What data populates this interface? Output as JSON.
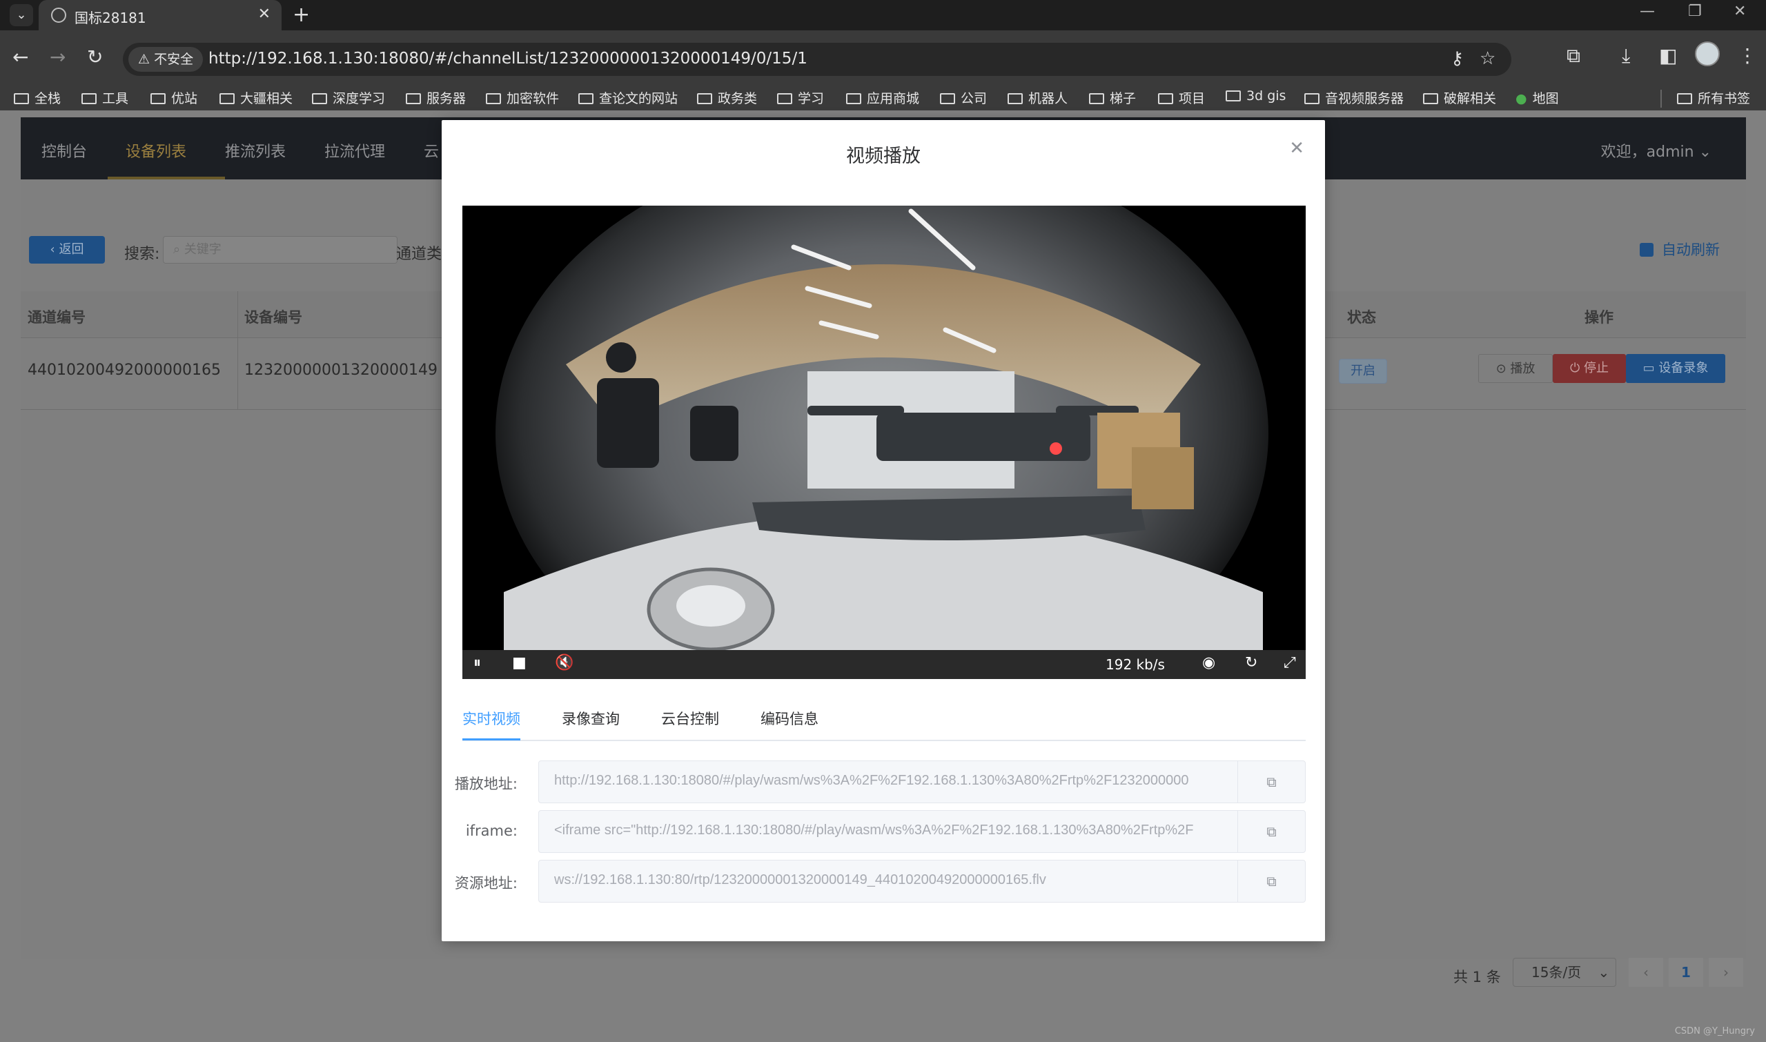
{
  "browser": {
    "tab_title": "国标28181",
    "insecure_label": "不安全",
    "url": "http://192.168.1.130:18080/#/channelList/12320000001320000149/0/15/1",
    "bookmarks": [
      "全栈",
      "工具",
      "优站",
      "大疆相关",
      "深度学习",
      "服务器",
      "加密软件",
      "查论文的网站",
      "政务类",
      "学习",
      "应用商城",
      "公司",
      "机器人",
      "梯子",
      "项目",
      "3d gis",
      "音视频服务器",
      "破解相关",
      "地图"
    ],
    "all_bookmarks": "所有书签"
  },
  "app": {
    "nav": [
      "控制台",
      "设备列表",
      "推流列表",
      "拉流代理",
      "云"
    ],
    "welcome": "欢迎，admin",
    "back_label": "返回",
    "search_label": "搜索:",
    "search_placeholder": "关键字",
    "channel_type_label": "通道类",
    "auto_refresh": "自动刷新",
    "table": {
      "headers": [
        "通道编号",
        "设备编号",
        "状态",
        "操作"
      ],
      "rows": [
        {
          "channel_id": "44010200492000000165",
          "device_id": "12320000001320000149",
          "status": "开启",
          "actions": [
            "播放",
            "停止",
            "设备录象"
          ]
        }
      ]
    },
    "pager": {
      "total": "共 1 条",
      "page_size": "15条/页",
      "current": "1"
    },
    "watermark": "CSDN @Y_Hungry"
  },
  "dialog": {
    "title": "视频播放",
    "bitrate": "192 kb/s",
    "tabs": [
      "实时视频",
      "录像查询",
      "云台控制",
      "编码信息"
    ],
    "fields": [
      {
        "label": "播放地址:",
        "value": "http://192.168.1.130:18080/#/play/wasm/ws%3A%2F%2F192.168.1.130%3A80%2Frtp%2F1232000000"
      },
      {
        "label": "iframe:",
        "value": "<iframe src=\"http://192.168.1.130:18080/#/play/wasm/ws%3A%2F%2F192.168.1.130%3A80%2Frtp%2F"
      },
      {
        "label": "资源地址:",
        "value": "ws://192.168.1.130:80/rtp/12320000001320000149_44010200492000000165.flv"
      }
    ]
  },
  "colors": {
    "primary": "#409eff",
    "danger": "#f56c6c",
    "nav_active": "#e6a23c"
  }
}
